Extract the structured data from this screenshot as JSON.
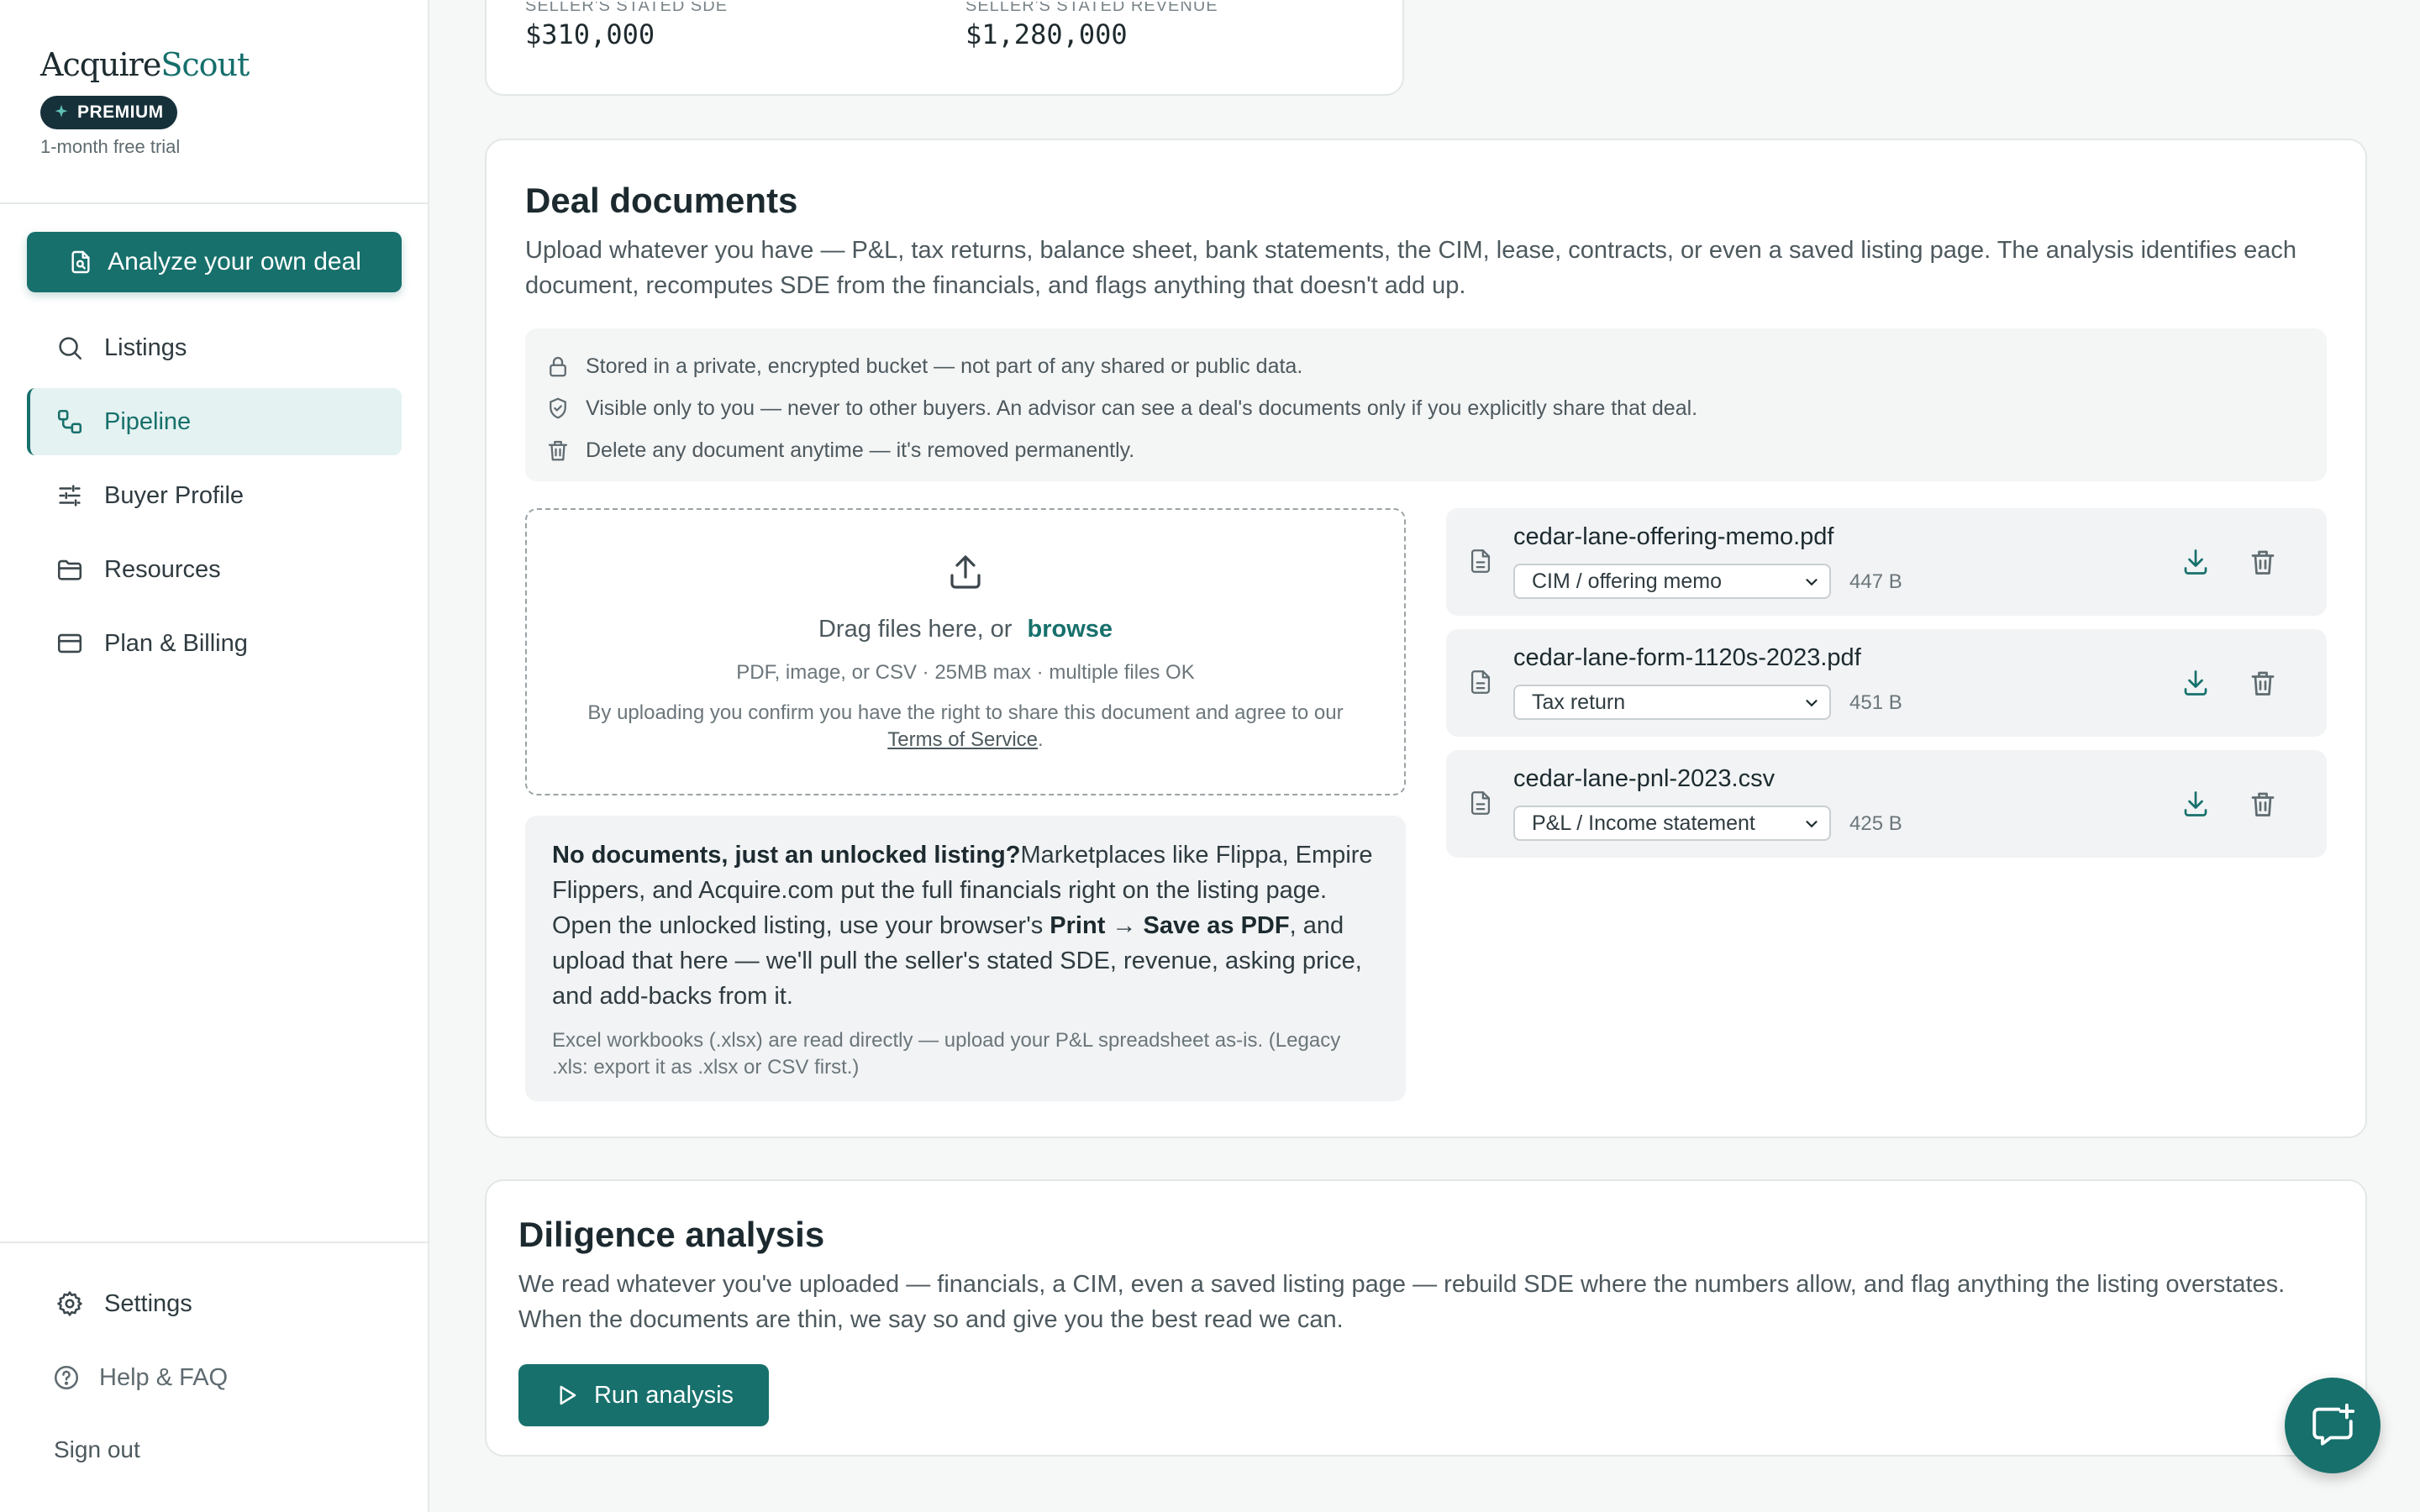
{
  "brand": {
    "logo_part1": "Acquire",
    "logo_part2": "Scout",
    "badge": "PREMIUM",
    "trial": "1-month free trial"
  },
  "sidebar": {
    "cta_label": "Analyze your own deal",
    "nav": [
      {
        "label": "Listings",
        "icon": "search-icon"
      },
      {
        "label": "Pipeline",
        "icon": "pipeline-icon",
        "active": true
      },
      {
        "label": "Buyer Profile",
        "icon": "sliders-icon"
      },
      {
        "label": "Resources",
        "icon": "folder-icon"
      },
      {
        "label": "Plan & Billing",
        "icon": "credit-card-icon"
      }
    ],
    "bottom": [
      {
        "label": "Settings",
        "icon": "gear-icon"
      },
      {
        "label": "Help & FAQ",
        "icon": "help-icon"
      }
    ],
    "signout": "Sign out"
  },
  "summary": {
    "sde_label": "SELLER'S STATED SDE",
    "sde_value": "$310,000",
    "revenue_label": "SELLER'S STATED REVENUE",
    "revenue_value": "$1,280,000"
  },
  "documents": {
    "title": "Deal documents",
    "description": "Upload whatever you have — P&L, tax returns, balance sheet, bank statements, the CIM, lease, contracts, or even a saved listing page. The analysis identifies each document, recomputes SDE from the financials, and flags anything that doesn't add up.",
    "privacy": [
      "Stored in a private, encrypted bucket — not part of any shared or public data.",
      "Visible only to you — never to other buyers. An advisor can see a deal's documents only if you explicitly share that deal.",
      "Delete any document anytime — it's removed permanently."
    ],
    "dropzone": {
      "main": "Drag files here, or",
      "browse": "browse",
      "sub": "PDF, image, or CSV · 25MB max · multiple files OK",
      "terms_prefix": "By uploading you confirm you have the right to share this document and agree to our",
      "terms_link": "Terms of Service",
      "terms_suffix": "."
    },
    "tip": {
      "lead": "No documents, just an unlocked listing?",
      "text1": "Marketplaces like Flippa, Empire Flippers, and Acquire.com put the full financials right on the listing page. Open the unlocked listing, use your browser's ",
      "print": "Print",
      "arrow": " → ",
      "save": "Save as PDF",
      "text2": ", and upload that here — we'll pull the seller's stated SDE, revenue, asking price, and add-backs from it.",
      "sub": "Excel workbooks (.xlsx) are read directly — upload your P&L spreadsheet as-is. (Legacy .xls: export it as .xlsx or CSV first.)"
    },
    "files": [
      {
        "name": "cedar-lane-offering-memo.pdf",
        "type": "CIM / offering memo",
        "size": "447 B"
      },
      {
        "name": "cedar-lane-form-1120s-2023.pdf",
        "type": "Tax return",
        "size": "451 B"
      },
      {
        "name": "cedar-lane-pnl-2023.csv",
        "type": "P&L / Income statement",
        "size": "425 B"
      }
    ]
  },
  "analysis": {
    "title": "Diligence analysis",
    "description": "We read whatever you've uploaded — financials, a CIM, even a saved listing page — rebuild SDE where the numbers allow, and flag anything the listing overstates. When the documents are thin, we say so and give you the best read we can.",
    "run_label": "Run analysis"
  },
  "colors": {
    "accent": "#17706c",
    "badge": "#17313a"
  }
}
